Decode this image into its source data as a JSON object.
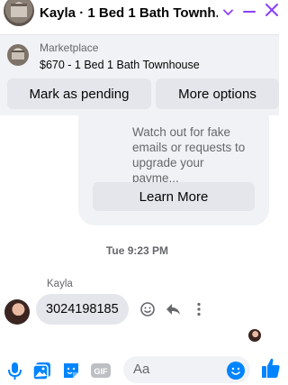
{
  "header": {
    "title": "Kayla · 1 Bed 1 Bath Townh...",
    "accent": "#8a3ffc"
  },
  "banner": {
    "label": "Marketplace",
    "title": "$670 - 1 Bed 1 Bath Townhouse",
    "pending_label": "Mark as pending",
    "more_label": "More options"
  },
  "card": {
    "text": "Watch out for fake emails or requests to upgrade your payme...",
    "learn_more_label": "Learn More"
  },
  "timestamp": "Tue 9:23 PM",
  "message": {
    "sender": "Kayla",
    "text": "3024198185"
  },
  "composer": {
    "placeholder": "Aa"
  },
  "colors": {
    "messenger_blue": "#0084ff",
    "bubble_gray": "#e4e6eb",
    "banner_bg": "#f0f2f5"
  }
}
